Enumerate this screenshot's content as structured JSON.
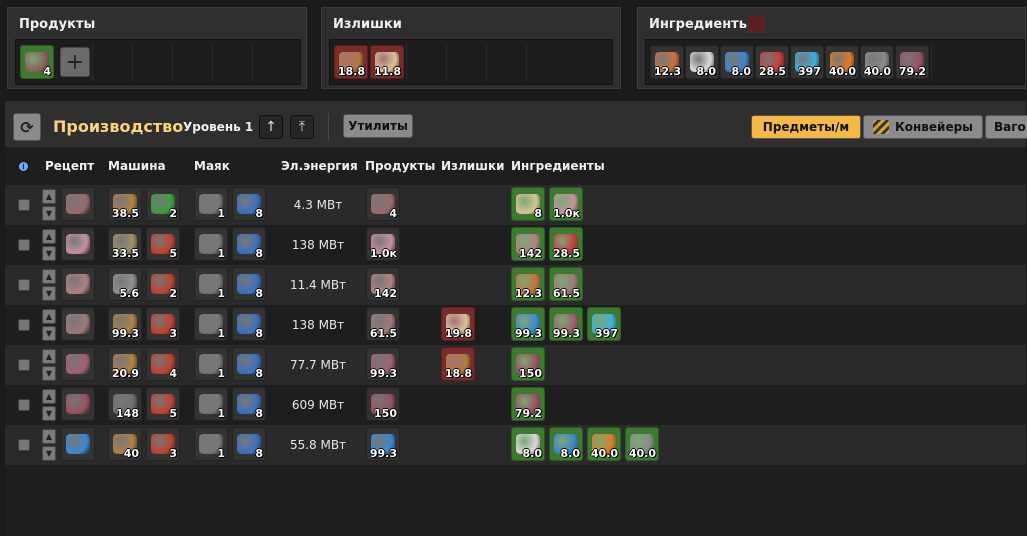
{
  "top_panels": {
    "products": {
      "title": "Продукты",
      "items": [
        {
          "icon": "plate-icon",
          "value": "4",
          "color": "#8c5f5a"
        }
      ]
    },
    "surplus": {
      "title": "Излишки",
      "items": [
        {
          "icon": "ore-icon",
          "value": "18.8",
          "color": "#b07c3a"
        },
        {
          "icon": "sand-icon",
          "value": "11.8",
          "color": "#d6c59a"
        }
      ]
    },
    "ingredients": {
      "title": "Ингредиенты",
      "items": [
        {
          "icon": "wire-icon",
          "value": "12.3",
          "color": "#c9703a"
        },
        {
          "icon": "ingot-icon",
          "value": "8.0",
          "color": "#d9dadc"
        },
        {
          "icon": "rod-icon",
          "value": "8.0",
          "color": "#3a86c9"
        },
        {
          "icon": "crystal-red-icon",
          "value": "28.5",
          "color": "#c83a3a"
        },
        {
          "icon": "crystal-blue-icon",
          "value": "397",
          "color": "#3ab0e0"
        },
        {
          "icon": "orb-icon",
          "value": "40.0",
          "color": "#e07a2a"
        },
        {
          "icon": "stone-icon",
          "value": "40.0",
          "color": "#8a8a8a"
        },
        {
          "icon": "ore-chunk-icon",
          "value": "79.2",
          "color": "#9a5060"
        }
      ]
    }
  },
  "toolbar": {
    "title": "Производство",
    "level": "Уровень 1",
    "utilities": "Утилиты",
    "tabs": [
      "Предметы/м",
      "Конвейеры",
      "Ваго"
    ]
  },
  "headers": [
    "Рецепт",
    "Машина",
    "Маяк",
    "Эл.энергия",
    "Продукты",
    "Излишки",
    "Ингредиенты"
  ],
  "rows": [
    {
      "recipe": {
        "icon": "plate-icon",
        "color": "#9a6a6a"
      },
      "machine": [
        {
          "icon": "assembler-icon",
          "value": "38.5",
          "color": "#b08040"
        },
        {
          "icon": "module-green-icon",
          "value": "2",
          "color": "#3aa040"
        }
      ],
      "beacon": [
        {
          "icon": "beacon-icon",
          "value": "1",
          "color": "#777"
        },
        {
          "icon": "module-blue-icon",
          "value": "8",
          "color": "#3a70c0"
        }
      ],
      "power": "4.3 МВт",
      "products": [
        {
          "icon": "plate-icon",
          "value": "4",
          "color": "#9a6a6a"
        }
      ],
      "surplus": [],
      "ingredients": [
        {
          "icon": "sand-icon",
          "value": "8",
          "color": "#d6c59a"
        },
        {
          "icon": "powder-icon",
          "value": "1.0к",
          "color": "#c890a0"
        }
      ]
    },
    {
      "recipe": {
        "icon": "powder-icon",
        "color": "#c890a0"
      },
      "machine": [
        {
          "icon": "crusher-icon",
          "value": "33.5",
          "color": "#a09060"
        },
        {
          "icon": "module-red-icon",
          "value": "5",
          "color": "#c04030"
        }
      ],
      "beacon": [
        {
          "icon": "beacon-icon",
          "value": "1",
          "color": "#777"
        },
        {
          "icon": "module-blue-icon",
          "value": "8",
          "color": "#3a70c0"
        }
      ],
      "power": "138 МВт",
      "products": [
        {
          "icon": "powder-icon",
          "value": "1.0к",
          "color": "#c890a0"
        }
      ],
      "surplus": [],
      "ingredients": [
        {
          "icon": "dust-icon",
          "value": "142",
          "color": "#b08080"
        },
        {
          "icon": "crystal-red-icon",
          "value": "28.5",
          "color": "#c83a3a"
        }
      ]
    },
    {
      "recipe": {
        "icon": "dust-icon",
        "color": "#b08080"
      },
      "machine": [
        {
          "icon": "mixer-icon",
          "value": "5.6",
          "color": "#909090"
        },
        {
          "icon": "module-red-icon",
          "value": "2",
          "color": "#c04030"
        }
      ],
      "beacon": [
        {
          "icon": "beacon-icon",
          "value": "1",
          "color": "#777"
        },
        {
          "icon": "module-blue-icon",
          "value": "8",
          "color": "#3a70c0"
        }
      ],
      "power": "11.4 МВт",
      "products": [
        {
          "icon": "dust-icon",
          "value": "142",
          "color": "#b08080"
        }
      ],
      "surplus": [],
      "ingredients": [
        {
          "icon": "wire-icon",
          "value": "12.3",
          "color": "#c9703a"
        },
        {
          "icon": "dust-icon",
          "value": "61.5",
          "color": "#a07878"
        }
      ]
    },
    {
      "recipe": {
        "icon": "dust-icon",
        "color": "#a07878"
      },
      "machine": [
        {
          "icon": "assembler-icon",
          "value": "99.3",
          "color": "#b08040"
        },
        {
          "icon": "module-red-icon",
          "value": "3",
          "color": "#c04030"
        }
      ],
      "beacon": [
        {
          "icon": "beacon-icon",
          "value": "1",
          "color": "#777"
        },
        {
          "icon": "module-blue-icon",
          "value": "8",
          "color": "#3a70c0"
        }
      ],
      "power": "138 МВт",
      "products": [
        {
          "icon": "dust-icon",
          "value": "61.5",
          "color": "#a07878"
        }
      ],
      "surplus": [
        {
          "icon": "sand-icon",
          "value": "19.8",
          "color": "#d6c59a"
        }
      ],
      "ingredients": [
        {
          "icon": "blue-balls-icon",
          "value": "99.3",
          "color": "#3a8ad0"
        },
        {
          "icon": "gravel-icon",
          "value": "99.3",
          "color": "#a06070"
        },
        {
          "icon": "crystal-blue-icon",
          "value": "397",
          "color": "#3ab0e0"
        }
      ]
    },
    {
      "recipe": {
        "icon": "gravel-icon",
        "color": "#a06070"
      },
      "machine": [
        {
          "icon": "assembler-icon",
          "value": "20.9",
          "color": "#b08040"
        },
        {
          "icon": "module-red-icon",
          "value": "4",
          "color": "#c04030"
        }
      ],
      "beacon": [
        {
          "icon": "beacon-icon",
          "value": "1",
          "color": "#777"
        },
        {
          "icon": "module-blue-icon",
          "value": "8",
          "color": "#3a70c0"
        }
      ],
      "power": "77.7 МВт",
      "products": [
        {
          "icon": "gravel-icon",
          "value": "99.3",
          "color": "#a06070"
        }
      ],
      "surplus": [
        {
          "icon": "ore-icon",
          "value": "18.8",
          "color": "#b07c3a"
        }
      ],
      "ingredients": [
        {
          "icon": "ore-chunk-icon",
          "value": "150",
          "color": "#9a5060"
        }
      ]
    },
    {
      "recipe": {
        "icon": "ore-chunk-icon",
        "color": "#9a5060"
      },
      "machine": [
        {
          "icon": "drill-icon",
          "value": "148",
          "color": "#707070"
        },
        {
          "icon": "module-red-icon",
          "value": "5",
          "color": "#c04030"
        }
      ],
      "beacon": [
        {
          "icon": "beacon-icon",
          "value": "1",
          "color": "#777"
        },
        {
          "icon": "module-blue-icon",
          "value": "8",
          "color": "#3a70c0"
        }
      ],
      "power": "609 МВт",
      "products": [
        {
          "icon": "ore-chunk-icon",
          "value": "150",
          "color": "#9a5060"
        }
      ],
      "surplus": [],
      "ingredients": [
        {
          "icon": "ore-chunk-icon",
          "value": "79.2",
          "color": "#9a5060"
        }
      ]
    },
    {
      "recipe": {
        "icon": "blue-balls-icon",
        "color": "#3a8ad0"
      },
      "machine": [
        {
          "icon": "assembler-icon",
          "value": "40",
          "color": "#b08040"
        },
        {
          "icon": "module-red-icon",
          "value": "3",
          "color": "#c04030"
        }
      ],
      "beacon": [
        {
          "icon": "beacon-icon",
          "value": "1",
          "color": "#777"
        },
        {
          "icon": "module-blue-icon",
          "value": "8",
          "color": "#3a70c0"
        }
      ],
      "power": "55.8 МВт",
      "products": [
        {
          "icon": "blue-balls-icon",
          "value": "99.3",
          "color": "#3a8ad0"
        }
      ],
      "surplus": [],
      "ingredients": [
        {
          "icon": "ingot-icon",
          "value": "8.0",
          "color": "#d9dadc"
        },
        {
          "icon": "rod-icon",
          "value": "8.0",
          "color": "#3a86c9"
        },
        {
          "icon": "orb-icon",
          "value": "40.0",
          "color": "#e07a2a"
        },
        {
          "icon": "stone-icon",
          "value": "40.0",
          "color": "#8a8a8a"
        }
      ]
    }
  ]
}
